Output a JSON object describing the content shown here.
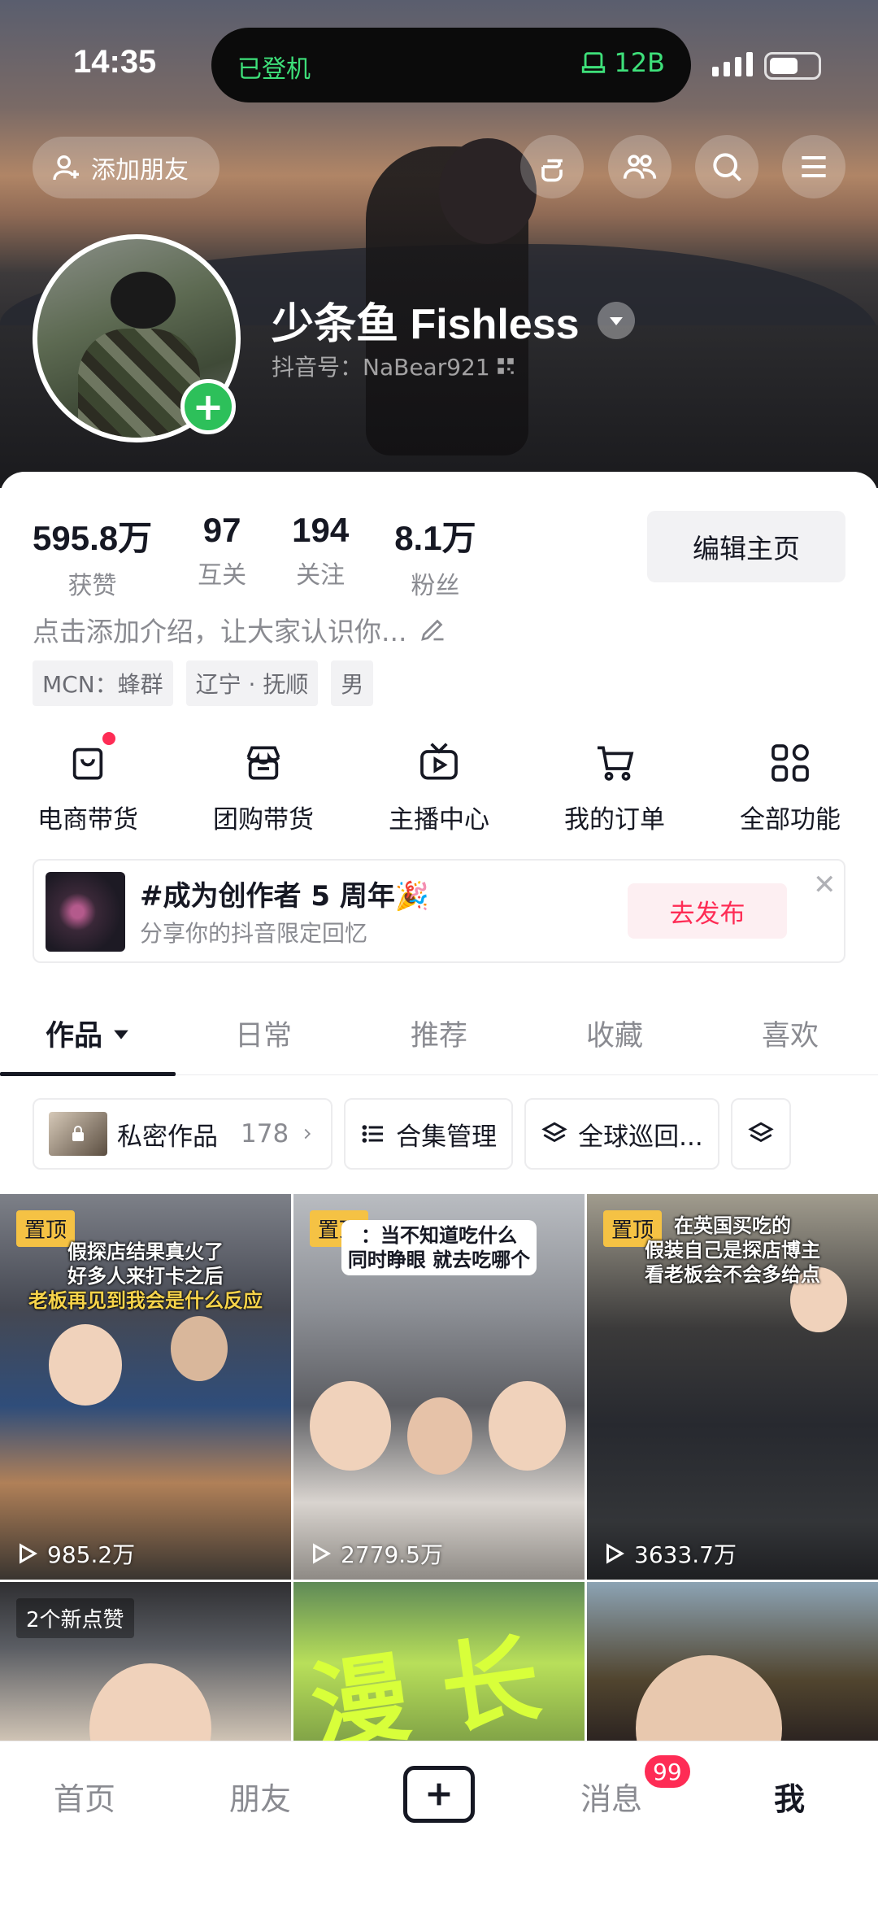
{
  "status": {
    "time": "14:35",
    "island_left": "已登机",
    "island_right": "12B"
  },
  "header": {
    "add_friend": "添加朋友",
    "icons": [
      "hand-point-icon",
      "friends-icon",
      "search-icon",
      "menu-icon"
    ]
  },
  "profile": {
    "nickname": "少条鱼 Fishless",
    "douyin_id": "抖音号：NaBear921"
  },
  "stats": [
    {
      "value": "595.8万",
      "label": "获赞"
    },
    {
      "value": "97",
      "label": "互关"
    },
    {
      "value": "194",
      "label": "关注"
    },
    {
      "value": "8.1万",
      "label": "粉丝"
    }
  ],
  "edit_button": "编辑主页",
  "intro": "点击添加介绍，让大家认识你...",
  "tags": [
    "MCN：蜂群",
    "辽宁 · 抚顺",
    "男"
  ],
  "features": [
    {
      "icon": "shopping-bag-icon",
      "label": "电商带货"
    },
    {
      "icon": "store-icon",
      "label": "团购带货"
    },
    {
      "icon": "tv-play-icon",
      "label": "主播中心"
    },
    {
      "icon": "cart-icon",
      "label": "我的订单"
    },
    {
      "icon": "grid-icon",
      "label": "全部功能"
    }
  ],
  "promo": {
    "title": "#成为创作者 5 周年🎉",
    "subtitle": "分享你的抖音限定回忆",
    "button": "去发布"
  },
  "tabs": [
    "作品",
    "日常",
    "推荐",
    "收藏",
    "喜欢"
  ],
  "chips": {
    "private_label": "私密作品",
    "private_count": "178",
    "collection": "合集管理",
    "tour": "全球巡回..."
  },
  "videos": [
    {
      "pin": "置顶",
      "cap1": "假探店结果真火了",
      "cap2": "好多人来打卡之后",
      "cap3": "老板再见到我会是什么反应",
      "plays": "985.2万"
    },
    {
      "pin": "置顶",
      "cap1": "：当不知道吃什么",
      "cap2": "同时睁眼 就去吃哪个",
      "plays": "2779.5万"
    },
    {
      "pin": "置顶",
      "cap1": "在英国买吃的",
      "cap2": "假装自己是探店博主",
      "cap3": "看老板会不会多给点",
      "plays": "3633.7万"
    },
    {
      "new_likes": "2个新点赞"
    },
    {},
    {}
  ],
  "nav": {
    "home": "首页",
    "friends": "朋友",
    "messages": "消息",
    "messages_badge": "99",
    "me": "我"
  }
}
